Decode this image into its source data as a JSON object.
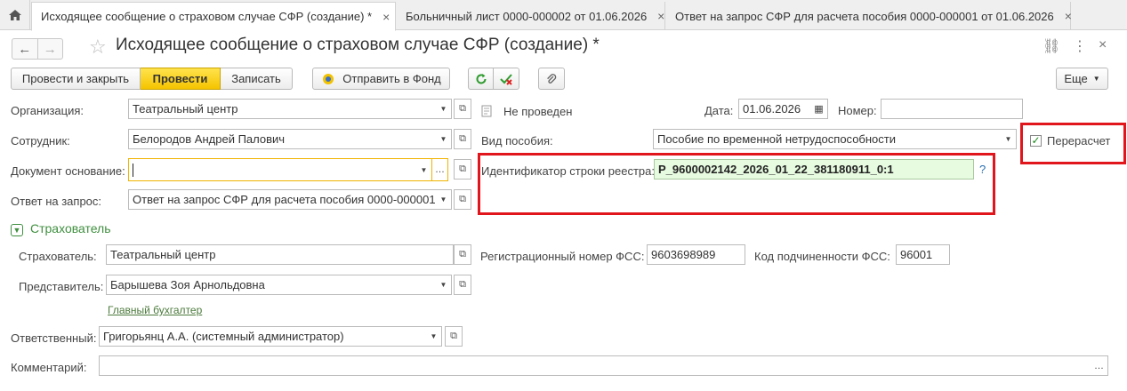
{
  "tabs": [
    {
      "label": "Исходящее сообщение о страховом случае СФР (создание) *",
      "close": "×"
    },
    {
      "label": "Больничный лист 0000-000002 от 01.06.2026",
      "close": "×"
    },
    {
      "label": "Ответ на запрос СФР для расчета пособия 0000-000001 от 01.06.2026",
      "close": "×"
    }
  ],
  "header": {
    "title": "Исходящее сообщение о страховом случае СФР (создание) *",
    "nav_back": "←",
    "nav_forward": "→",
    "star": "☆",
    "link_icon": "⛓",
    "menu_icon": "⋮",
    "close_icon": "×"
  },
  "toolbar": {
    "post_close": "Провести и закрыть",
    "post": "Провести",
    "save": "Записать",
    "send_fund": "Отправить в Фонд",
    "more": "Еще"
  },
  "form": {
    "org_label": "Организация:",
    "org_value": "Театральный центр",
    "status_text": "Не проведен",
    "date_label": "Дата:",
    "date_value": "01.06.2026",
    "number_label": "Номер:",
    "number_value": "",
    "employee_label": "Сотрудник:",
    "employee_value": "Белородов Андрей Палович",
    "benefit_type_label": "Вид пособия:",
    "benefit_type_value": "Пособие по временной нетрудоспособности",
    "recalc_label": "Перерасчет",
    "recalc_checked": true,
    "basis_label": "Документ основание:",
    "basis_value": "",
    "registry_id_label": "Идентификатор строки реестра:",
    "registry_id_value": "P_9600002142_2026_01_22_381180911_0:1",
    "help": "?",
    "answer_label": "Ответ на запрос:",
    "answer_value": "Ответ на запрос СФР для расчета пособия 0000-000001"
  },
  "insurer": {
    "section_title": "Страхователь",
    "insurer_label": "Страхователь:",
    "insurer_value": "Театральный центр",
    "reg_number_label": "Регистрационный номер ФСС:",
    "reg_number_value": "9603698989",
    "sub_code_label": "Код подчиненности ФСС:",
    "sub_code_value": "96001",
    "rep_label": "Представитель:",
    "rep_value": "Барышева Зоя Арнольдовна",
    "rep_position": "Главный бухгалтер"
  },
  "footer": {
    "responsible_label": "Ответственный:",
    "responsible_value": "Григорьянц А.А. (системный администратор)",
    "comment_label": "Комментарий:",
    "comment_value": ""
  },
  "colors": {
    "primary_button": "#f5c400",
    "highlight_red": "#e0161c",
    "green_field": "#e7fbe0",
    "section_green": "#3f8f3f"
  }
}
